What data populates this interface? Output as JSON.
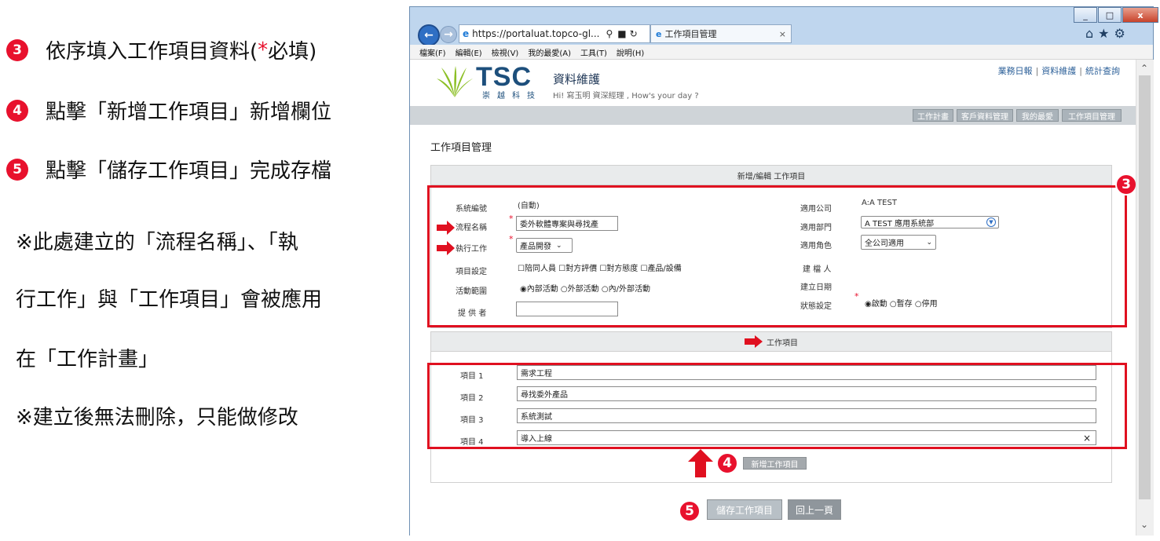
{
  "instructions": {
    "step3": {
      "num": "3",
      "text_before": "依序填入工作項目資料(",
      "req": "*",
      "text_after": "必填)"
    },
    "step4": {
      "num": "4",
      "text": "點擊「新增工作項目」新增欄位"
    },
    "step5": {
      "num": "5",
      "text": "點擊「儲存工作項目」完成存檔"
    },
    "note1_line1": "※此處建立的「流程名稱」、「執",
    "note1_line2": "行工作」與「工作項目」會被應用",
    "note1_line3": "在「工作計畫」",
    "note2": "※建立後無法刪除，只能做修改"
  },
  "browser": {
    "url": "https://portaluat.topco-gl...",
    "tab_title": "工作項目管理",
    "menu": [
      "檔案(F)",
      "編輯(E)",
      "檢視(V)",
      "我的最愛(A)",
      "工具(T)",
      "說明(H)"
    ],
    "win_min": "_",
    "win_max": "□",
    "win_close": "x",
    "tab_close": "×"
  },
  "site": {
    "logo": "TSC",
    "logo_sub": "崇越科技",
    "app_title": "資料維護",
    "greeting": "Hi! 寫玉明 資深經理 , How's your day ?",
    "toplinks": [
      "業務日報",
      "資料維護",
      "統計查詢"
    ],
    "link_sep": "|",
    "navtabs": [
      "工作計畫",
      "客戶資料管理",
      "我的最愛",
      "工作項目管理"
    ]
  },
  "page": {
    "heading": "工作項目管理",
    "panel1_title": "新增/編輯 工作項目",
    "panel2_title": "工作項目",
    "req_mark": "*",
    "form": {
      "sysno_label": "系統編號",
      "sysno_value": "(自動)",
      "flow_label": "流程名稱",
      "flow_value": "委外軟體專案與尋找產",
      "exec_label": "執行工作",
      "exec_value": "產品開發",
      "items_label": "項目設定",
      "items_opts": [
        "陪同人員",
        "對方評價",
        "對方態度",
        "產品/設備"
      ],
      "scope_label": "活動範圍",
      "scope_opts": [
        "內部活動",
        "外部活動",
        "內/外部活動"
      ],
      "provider_label": "提 供 者",
      "provider_value": "",
      "company_label": "適用公司",
      "company_value": "A:A TEST",
      "dept_label": "適用部門",
      "dept_value": "A TEST 應用系統部",
      "role_label": "適用角色",
      "role_value": "全公司適用",
      "creator_label": "建 檔 人",
      "created_label": "建立日期",
      "status_label": "狀態設定",
      "status_opts": [
        "啟動",
        "暫存",
        "停用"
      ]
    },
    "work_items": [
      {
        "label": "項目 1",
        "value": "需求工程"
      },
      {
        "label": "項目 2",
        "value": "尋找委外產品"
      },
      {
        "label": "項目 3",
        "value": "系統測試"
      },
      {
        "label": "項目 4",
        "value": "導入上線"
      }
    ],
    "clear_icon": "×",
    "add_button": "新增工作項目",
    "save_button": "儲存工作項目",
    "back_button": "回上一頁",
    "badge3": "3",
    "badge4": "4",
    "badge5": "5"
  },
  "colors": {
    "accent_red": "#e8112d",
    "brand_blue": "#1d4f7c",
    "logo_green": "#8cbf26"
  }
}
